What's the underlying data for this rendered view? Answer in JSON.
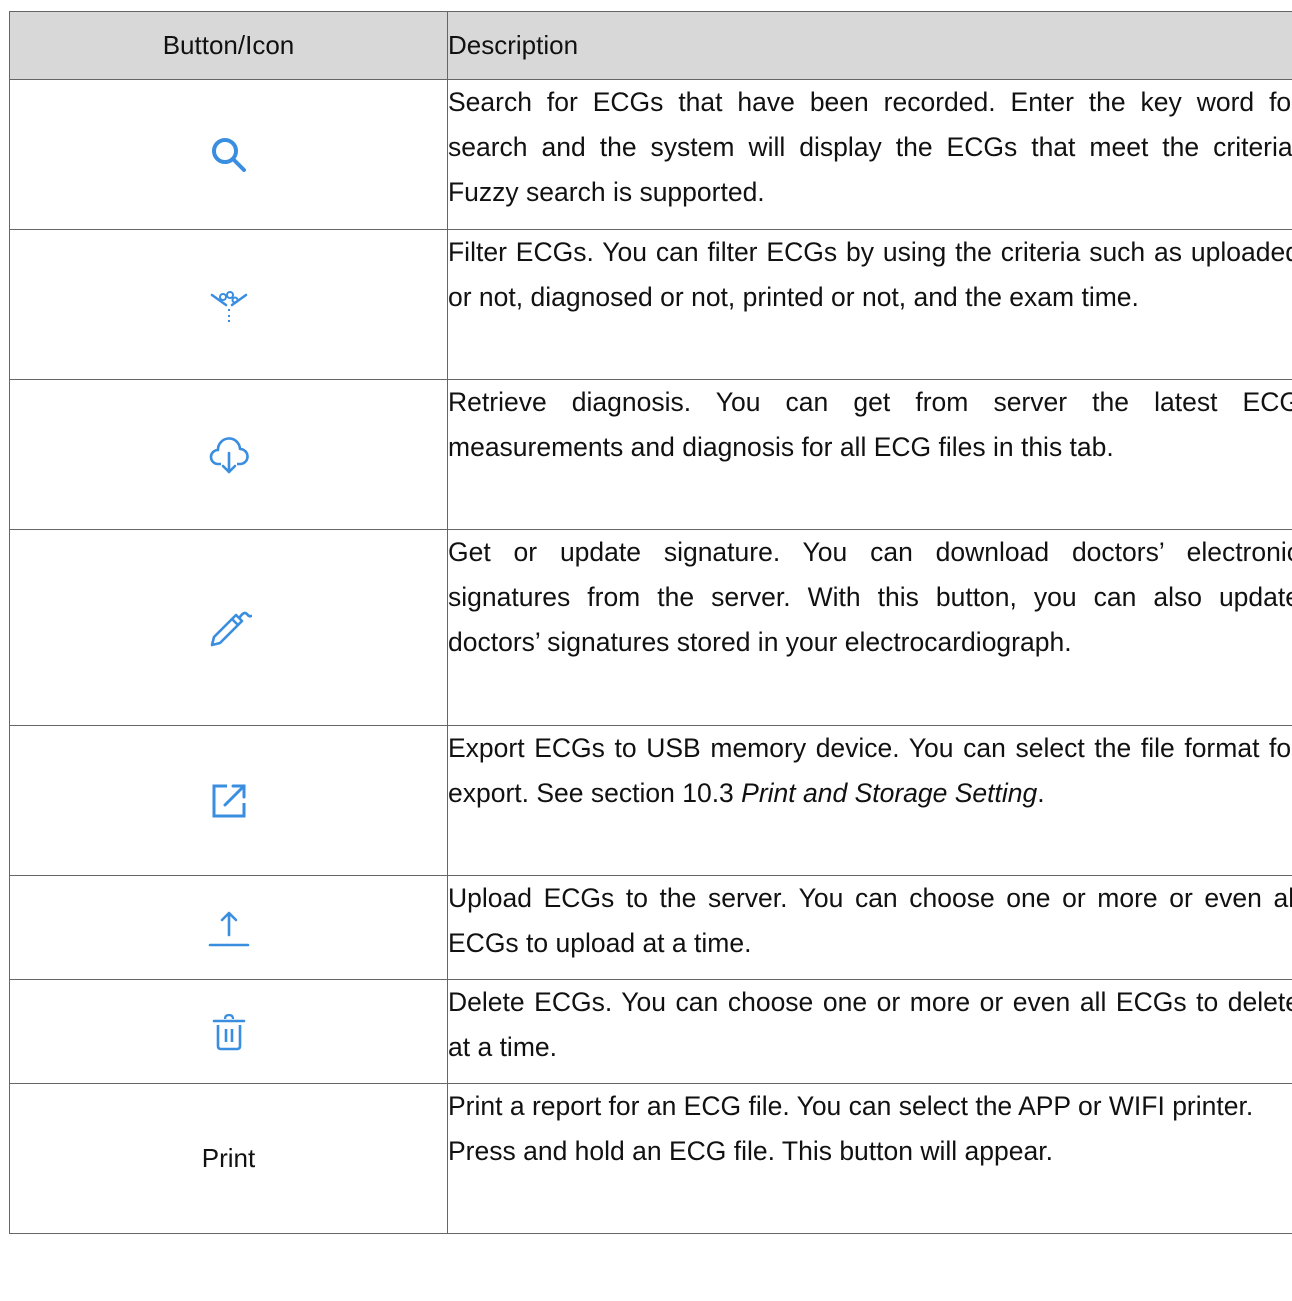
{
  "colors": {
    "header_bg": "#d8d8d8",
    "icon_blue": "#3a8ee0",
    "border": "#666666"
  },
  "table": {
    "headers": [
      "Button/Icon",
      "Description"
    ],
    "rows": [
      {
        "icon": "search-icon",
        "description": "Search for ECGs that have been recorded. Enter the key word for search and the system will display the ECGs that meet the criteria. Fuzzy search is supported."
      },
      {
        "icon": "filter-icon",
        "description": "Filter ECGs. You can filter ECGs by using the criteria such as uploaded or not, diagnosed or not, printed or not, and the exam time."
      },
      {
        "icon": "cloud-sync-icon",
        "description": "Retrieve diagnosis. You can get from server the latest ECG measurements and diagnosis for all ECG files in this tab."
      },
      {
        "icon": "signature-pen-icon",
        "description": "Get or update signature. You can download doctors’ electronic signatures from the server. With this button, you can also update doctors’ signatures stored in your electrocardiograph."
      },
      {
        "icon": "export-icon",
        "description_before": "Export ECGs to USB memory device. You can select the file format for export. See section 10.3 ",
        "description_ref": "Print and Storage Setting",
        "description_after": "."
      },
      {
        "icon": "upload-icon",
        "description": "Upload ECGs to the server. You can choose one or more or even all ECGs to upload at a time."
      },
      {
        "icon": "trash-icon",
        "description": "Delete ECGs. You can choose one or more or even all ECGs to delete at a time."
      },
      {
        "label": "Print",
        "description_lines": [
          "Print a report for an ECG file. You can select the APP or WIFI printer.",
          "Press and hold an ECG file. This button will appear."
        ]
      }
    ]
  }
}
